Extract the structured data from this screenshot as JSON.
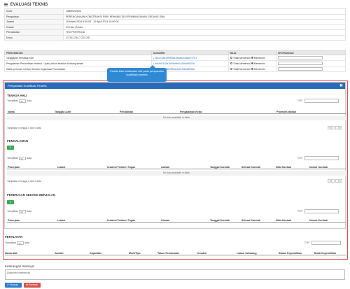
{
  "page": {
    "title": "EVALUASI TEKNIS"
  },
  "info_rows": [
    {
      "key": "Kode",
      "value": "15BN92/2024"
    },
    {
      "key": "Pengadaan",
      "value": "PERENCANAAN KONSTRUKSI FISIK REHABILITASI PEMBANGUNAN GEDUNG SMA"
    },
    {
      "key": "Jadwal",
      "value": "18 Maret 2024 8:00:00 - 19 April 2024 16:00:00"
    },
    {
      "key": "Durasi",
      "value": "23 Hari | 8 Jam"
    },
    {
      "key": "Perusahaan",
      "value": "TEO PERTRIZIA"
    },
    {
      "key": "Nonp",
      "value": "12.341.234.7-213.241"
    }
  ],
  "req_table": {
    "headers": [
      "PERSYARATAN",
      "DOKUMEN",
      "NILAI",
      "KETERANGAN"
    ],
    "rows": [
      {
        "persyaratan": "Tanggapan Terhadap KAK",
        "dokumen": "⤓ 3bcc73d61f99f3bcc0bcabec4a86747f1f",
        "opt1": "Tidak Memenuhi",
        "opt2": "Memenuhi"
      },
      {
        "persyaratan": "Pengalaman Perusahaan minimal 1 (satu) tahun terakhir di bidang terkait",
        "dokumen": "⤓ e9c9d21d2a1b90fc9bb1c24b6f3f474b",
        "opt1": "Tidak Memenuhi",
        "opt2": "Memenuhi"
      },
      {
        "persyaratan": "Daftar personel inti dan Struktur Organisasi Perusahaan",
        "dokumen": "⤓ e4e5e89036b0f81ac2abcf31ad5066a",
        "opt1": "Tidak Memenuhi",
        "opt2": "Memenuhi"
      }
    ]
  },
  "tooltip": {
    "text": "Panitia bisa melakukan edit pada persyaratan kualifikasi peserta"
  },
  "modal": {
    "title": "Persyaratan Kualifikasi Peserta",
    "close": "✖",
    "tampilkan": "Tampilkan",
    "len_value": "10",
    "data": "data",
    "cari": "Cari:",
    "no_data": "No data available in table",
    "info": "Tampilkan 0 hingga 0 dari 0 data",
    "pager": [
      "«",
      "‹",
      "›",
      "»"
    ],
    "sections": [
      {
        "title": "TENAGA AHLI",
        "headers": [
          "Nama",
          "Tanggal Lahir",
          "Pendidikan",
          "Pengalaman Kerja",
          "Profesi/Keahlian"
        ]
      },
      {
        "title": "PENGALAMAN",
        "headers": [
          "Pekerjaan",
          "Lokasi",
          "Instansi Pemberi Tugas",
          "Alamat",
          "Tanggal Kontrak",
          "Selesai Kontrak",
          "Nilai Kontrak",
          "Nomor Kontrak"
        ]
      },
      {
        "title": "PEKERJAAN SEDANG BERJALAN",
        "headers": [
          "Pekerjaan",
          "Lokasi",
          "Instansi Pemberi Tugas",
          "Alamat",
          "Tanggal Kontrak",
          "Selesai Kontrak",
          "Nilai Kontrak",
          "Nomor Kontrak"
        ]
      }
    ]
  },
  "peralatan": {
    "title": "PERALATAN",
    "headers": [
      "Nama Alat",
      "Jumlah",
      "Kapasitas",
      "Merk/Tipe",
      "Tahun Pembuatan",
      "Kondisi",
      "Lokasi Sekarang",
      "Status Kepemilikan",
      "Bukti Kepemilikan"
    ]
  },
  "keterangan": {
    "label": "Keterangan Isiannya:",
    "value": "Dokumen memenuhi"
  },
  "buttons": {
    "save": "✔ Simpan",
    "cancel": "✖ Kembali"
  },
  "colors": {
    "primary": "#2a6bb8",
    "danger": "#e64d4d",
    "success": "#3aa855",
    "tooltip": "#2f8ad6"
  }
}
